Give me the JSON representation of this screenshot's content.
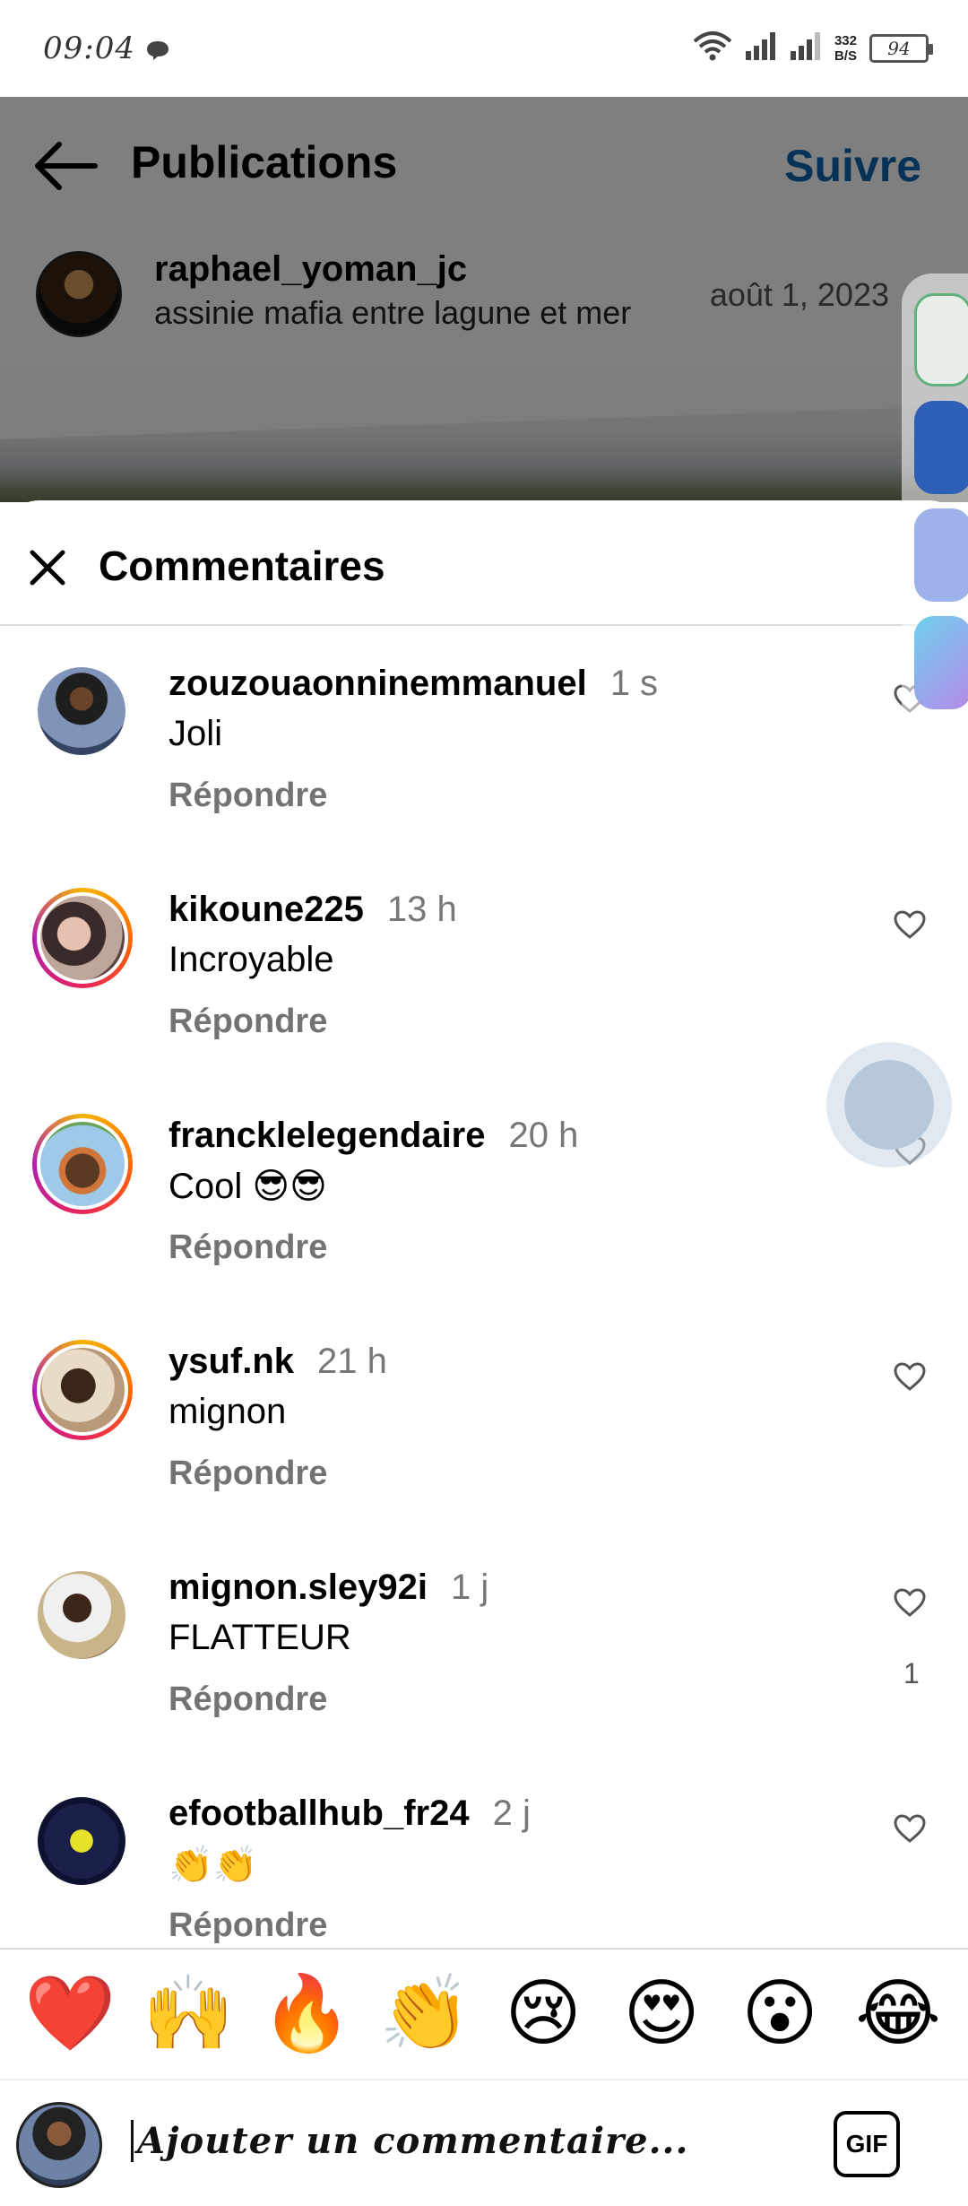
{
  "status_bar": {
    "time": "09:04",
    "net_speed_value": "332",
    "net_speed_unit": "B/S",
    "battery": "94"
  },
  "header": {
    "title": "Publications",
    "follow_label": "Suivre"
  },
  "post": {
    "username": "raphael_yoman_jc",
    "caption": "assinie mafia entre lagune et mer",
    "date": "août 1, 2023"
  },
  "comments_sheet": {
    "title": "Commentaires",
    "reply_label": "Répondre",
    "comments": [
      {
        "username": "zouzouaonninemmanuel",
        "time": "1 s",
        "text": "Joli",
        "likes": ""
      },
      {
        "username": "kikoune225",
        "time": "13 h",
        "text": "Incroyable",
        "likes": ""
      },
      {
        "username": "francklelegendaire",
        "time": "20 h",
        "text": "Cool 😎😎",
        "likes": ""
      },
      {
        "username": "ysuf.nk",
        "time": "21 h",
        "text": "mignon",
        "likes": ""
      },
      {
        "username": "mignon.sley92i",
        "time": "1 j",
        "text": "FLATTEUR",
        "likes": "1"
      },
      {
        "username": "efootballhub_fr24",
        "time": "2 j",
        "text": "👏👏",
        "likes": ""
      }
    ]
  },
  "emoji_bar": [
    "❤️",
    "🙌",
    "🔥",
    "👏",
    "😢",
    "😍",
    "😮",
    "😂"
  ],
  "compose": {
    "placeholder": "Ajouter un commentaire...",
    "gif_label": "GIF"
  },
  "colors": {
    "accent_blue": "#0a64ad",
    "secondary_text": "#737373",
    "story_ring": [
      "#f5b400",
      "#ff6a00",
      "#e8245a",
      "#b21fb0"
    ]
  }
}
